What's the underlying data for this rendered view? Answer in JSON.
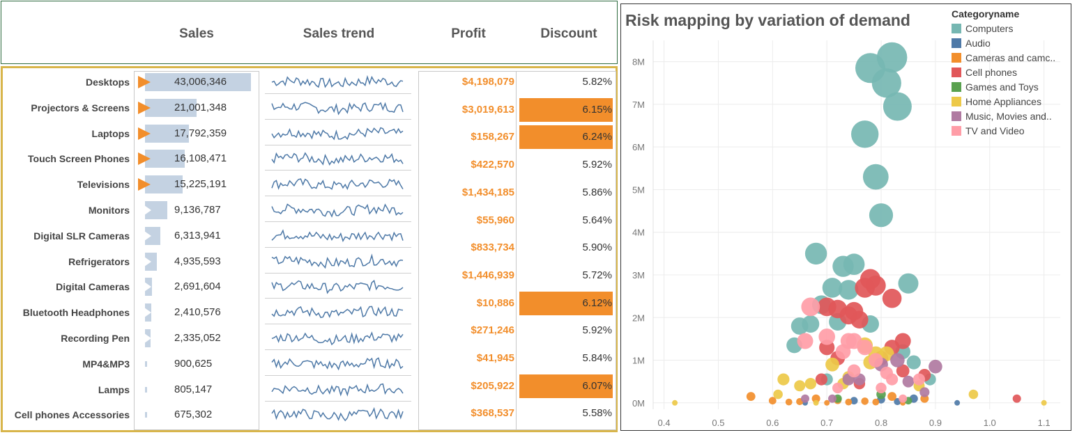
{
  "table": {
    "headers": {
      "sales": "Sales",
      "trend": "Sales trend",
      "profit": "Profit",
      "discount": "Discount"
    },
    "rows": [
      {
        "name": "Desktops",
        "sales": 43006346,
        "sales_label": "43,006,346",
        "indicator": "up",
        "profit": "$4,198,079",
        "discount": "5.82%",
        "disc_highlight": false
      },
      {
        "name": "Projectors & Screens",
        "sales": 21001348,
        "sales_label": "21,001,348",
        "indicator": "up",
        "profit": "$3,019,613",
        "discount": "6.15%",
        "disc_highlight": true
      },
      {
        "name": "Laptops",
        "sales": 17792359,
        "sales_label": "17,792,359",
        "indicator": "up",
        "profit": "$158,267",
        "discount": "6.24%",
        "disc_highlight": true
      },
      {
        "name": "Touch Screen Phones",
        "sales": 16108471,
        "sales_label": "16,108,471",
        "indicator": "up",
        "profit": "$422,570",
        "discount": "5.92%",
        "disc_highlight": false
      },
      {
        "name": "Televisions",
        "sales": 15225191,
        "sales_label": "15,225,191",
        "indicator": "up",
        "profit": "$1,434,185",
        "discount": "5.86%",
        "disc_highlight": false
      },
      {
        "name": "Monitors",
        "sales": 9136787,
        "sales_label": "9,136,787",
        "indicator": "down",
        "profit": "$55,960",
        "discount": "5.64%",
        "disc_highlight": false
      },
      {
        "name": "Digital SLR Cameras",
        "sales": 6313941,
        "sales_label": "6,313,941",
        "indicator": "down",
        "profit": "$833,734",
        "discount": "5.90%",
        "disc_highlight": false
      },
      {
        "name": "Refrigerators",
        "sales": 4935593,
        "sales_label": "4,935,593",
        "indicator": "down",
        "profit": "$1,446,939",
        "discount": "5.72%",
        "disc_highlight": false
      },
      {
        "name": "Digital Cameras",
        "sales": 2691604,
        "sales_label": "2,691,604",
        "indicator": "down",
        "profit": "$10,886",
        "discount": "6.12%",
        "disc_highlight": true
      },
      {
        "name": "Bluetooth Headphones",
        "sales": 2410576,
        "sales_label": "2,410,576",
        "indicator": "down",
        "profit": "$271,246",
        "discount": "5.92%",
        "disc_highlight": false
      },
      {
        "name": "Recording Pen",
        "sales": 2335052,
        "sales_label": "2,335,052",
        "indicator": "down",
        "profit": "$41,945",
        "discount": "5.84%",
        "disc_highlight": false
      },
      {
        "name": "MP4&MP3",
        "sales": 900625,
        "sales_label": "900,625",
        "indicator": "none",
        "profit": "$205,922",
        "discount": "6.07%",
        "disc_highlight": true
      },
      {
        "name": "Lamps",
        "sales": 805147,
        "sales_label": "805,147",
        "indicator": "none",
        "profit": "$368,537",
        "discount": "5.58%",
        "disc_highlight": false
      },
      {
        "name": "Cell phones Accessories",
        "sales": 675302,
        "sales_label": "675,302",
        "indicator": "none",
        "profit": "",
        "discount": "",
        "disc_highlight": false
      }
    ]
  },
  "colors": {
    "accent_orange": "#f28e2b",
    "bar_blue": "#c4d2e2",
    "trend_blue": "#4e79a7",
    "frame_gold": "#d8b54a"
  },
  "chart_data": {
    "type": "scatter",
    "title": "Risk mapping by variation of demand",
    "xlabel": "",
    "ylabel": "",
    "xlim": [
      0.38,
      1.13
    ],
    "ylim": [
      -150000,
      8500000
    ],
    "x_ticks": [
      "0.4",
      "0.5",
      "0.6",
      "0.7",
      "0.8",
      "0.9",
      "1.0",
      "1.1"
    ],
    "y_ticks": [
      "0M",
      "1M",
      "2M",
      "3M",
      "4M",
      "5M",
      "6M",
      "7M",
      "8M"
    ],
    "grid": true,
    "legend_title": "Categoryname",
    "legend_position": "top-right",
    "series": [
      {
        "name": "Computers",
        "color": "#76b7b2",
        "points": [
          [
            0.82,
            8100000
          ],
          [
            0.78,
            7850000
          ],
          [
            0.81,
            7500000
          ],
          [
            0.83,
            6950000
          ],
          [
            0.77,
            6300000
          ],
          [
            0.79,
            5300000
          ],
          [
            0.8,
            4400000
          ],
          [
            0.68,
            3500000
          ],
          [
            0.73,
            3200000
          ],
          [
            0.75,
            3250000
          ],
          [
            0.85,
            2800000
          ],
          [
            0.71,
            2700000
          ],
          [
            0.74,
            2650000
          ],
          [
            0.69,
            2300000
          ],
          [
            0.72,
            1900000
          ],
          [
            0.78,
            1850000
          ],
          [
            0.65,
            1800000
          ],
          [
            0.67,
            1850000
          ],
          [
            0.64,
            1350000
          ],
          [
            0.84,
            1200000
          ],
          [
            0.86,
            950000
          ],
          [
            0.7,
            550000
          ],
          [
            0.89,
            550000
          ]
        ]
      },
      {
        "name": "Audio",
        "color": "#4e79a7",
        "points": [
          [
            0.66,
            0
          ],
          [
            0.75,
            50000
          ],
          [
            0.8,
            80000
          ],
          [
            0.83,
            30000
          ],
          [
            0.86,
            100000
          ],
          [
            0.94,
            0
          ]
        ]
      },
      {
        "name": "Cameras and camc..",
        "color": "#f28e2b",
        "points": [
          [
            0.56,
            150000
          ],
          [
            0.6,
            50000
          ],
          [
            0.63,
            20000
          ],
          [
            0.65,
            30000
          ],
          [
            0.68,
            100000
          ],
          [
            0.7,
            0
          ],
          [
            0.72,
            60000
          ],
          [
            0.74,
            20000
          ],
          [
            0.77,
            40000
          ],
          [
            0.79,
            20000
          ],
          [
            0.82,
            150000
          ],
          [
            0.84,
            0
          ],
          [
            0.88,
            100000
          ]
        ]
      },
      {
        "name": "Cell phones",
        "color": "#e15759",
        "points": [
          [
            0.78,
            2900000
          ],
          [
            0.79,
            2750000
          ],
          [
            0.77,
            2700000
          ],
          [
            0.82,
            2450000
          ],
          [
            0.7,
            2250000
          ],
          [
            0.72,
            2200000
          ],
          [
            0.75,
            2150000
          ],
          [
            0.74,
            2050000
          ],
          [
            0.76,
            1950000
          ],
          [
            0.84,
            1450000
          ],
          [
            0.7,
            1300000
          ],
          [
            0.82,
            1300000
          ],
          [
            0.8,
            1050000
          ],
          [
            0.72,
            1050000
          ],
          [
            0.69,
            550000
          ],
          [
            0.76,
            450000
          ],
          [
            0.84,
            750000
          ],
          [
            0.88,
            650000
          ],
          [
            1.05,
            100000
          ]
        ]
      },
      {
        "name": "Games and Toys",
        "color": "#59a14f",
        "points": [
          [
            0.72,
            100000
          ],
          [
            0.8,
            200000
          ],
          [
            0.85,
            50000
          ]
        ]
      },
      {
        "name": "Home Appliances",
        "color": "#edc948",
        "points": [
          [
            0.42,
            0
          ],
          [
            0.62,
            550000
          ],
          [
            0.65,
            400000
          ],
          [
            0.67,
            450000
          ],
          [
            0.71,
            900000
          ],
          [
            0.73,
            450000
          ],
          [
            0.77,
            1350000
          ],
          [
            0.78,
            950000
          ],
          [
            0.79,
            1150000
          ],
          [
            0.81,
            1150000
          ],
          [
            0.74,
            600000
          ],
          [
            0.87,
            400000
          ],
          [
            0.61,
            200000
          ],
          [
            0.97,
            200000
          ],
          [
            1.1,
            0
          ],
          [
            0.68,
            0
          ]
        ]
      },
      {
        "name": "Music, Movies and..",
        "color": "#b07aa1",
        "points": [
          [
            0.83,
            1000000
          ],
          [
            0.8,
            900000
          ],
          [
            0.9,
            850000
          ],
          [
            0.74,
            550000
          ],
          [
            0.76,
            550000
          ],
          [
            0.85,
            500000
          ],
          [
            0.88,
            250000
          ],
          [
            0.66,
            100000
          ],
          [
            0.71,
            100000
          ]
        ]
      },
      {
        "name": "TV and Video",
        "color": "#ff9da7",
        "points": [
          [
            0.67,
            2250000
          ],
          [
            0.7,
            1550000
          ],
          [
            0.66,
            1450000
          ],
          [
            0.74,
            1450000
          ],
          [
            0.75,
            1450000
          ],
          [
            0.73,
            1200000
          ],
          [
            0.77,
            1300000
          ],
          [
            0.79,
            1000000
          ],
          [
            0.75,
            750000
          ],
          [
            0.81,
            700000
          ],
          [
            0.82,
            550000
          ],
          [
            0.87,
            550000
          ],
          [
            0.72,
            350000
          ],
          [
            0.8,
            350000
          ],
          [
            0.84,
            100000
          ]
        ]
      }
    ]
  }
}
